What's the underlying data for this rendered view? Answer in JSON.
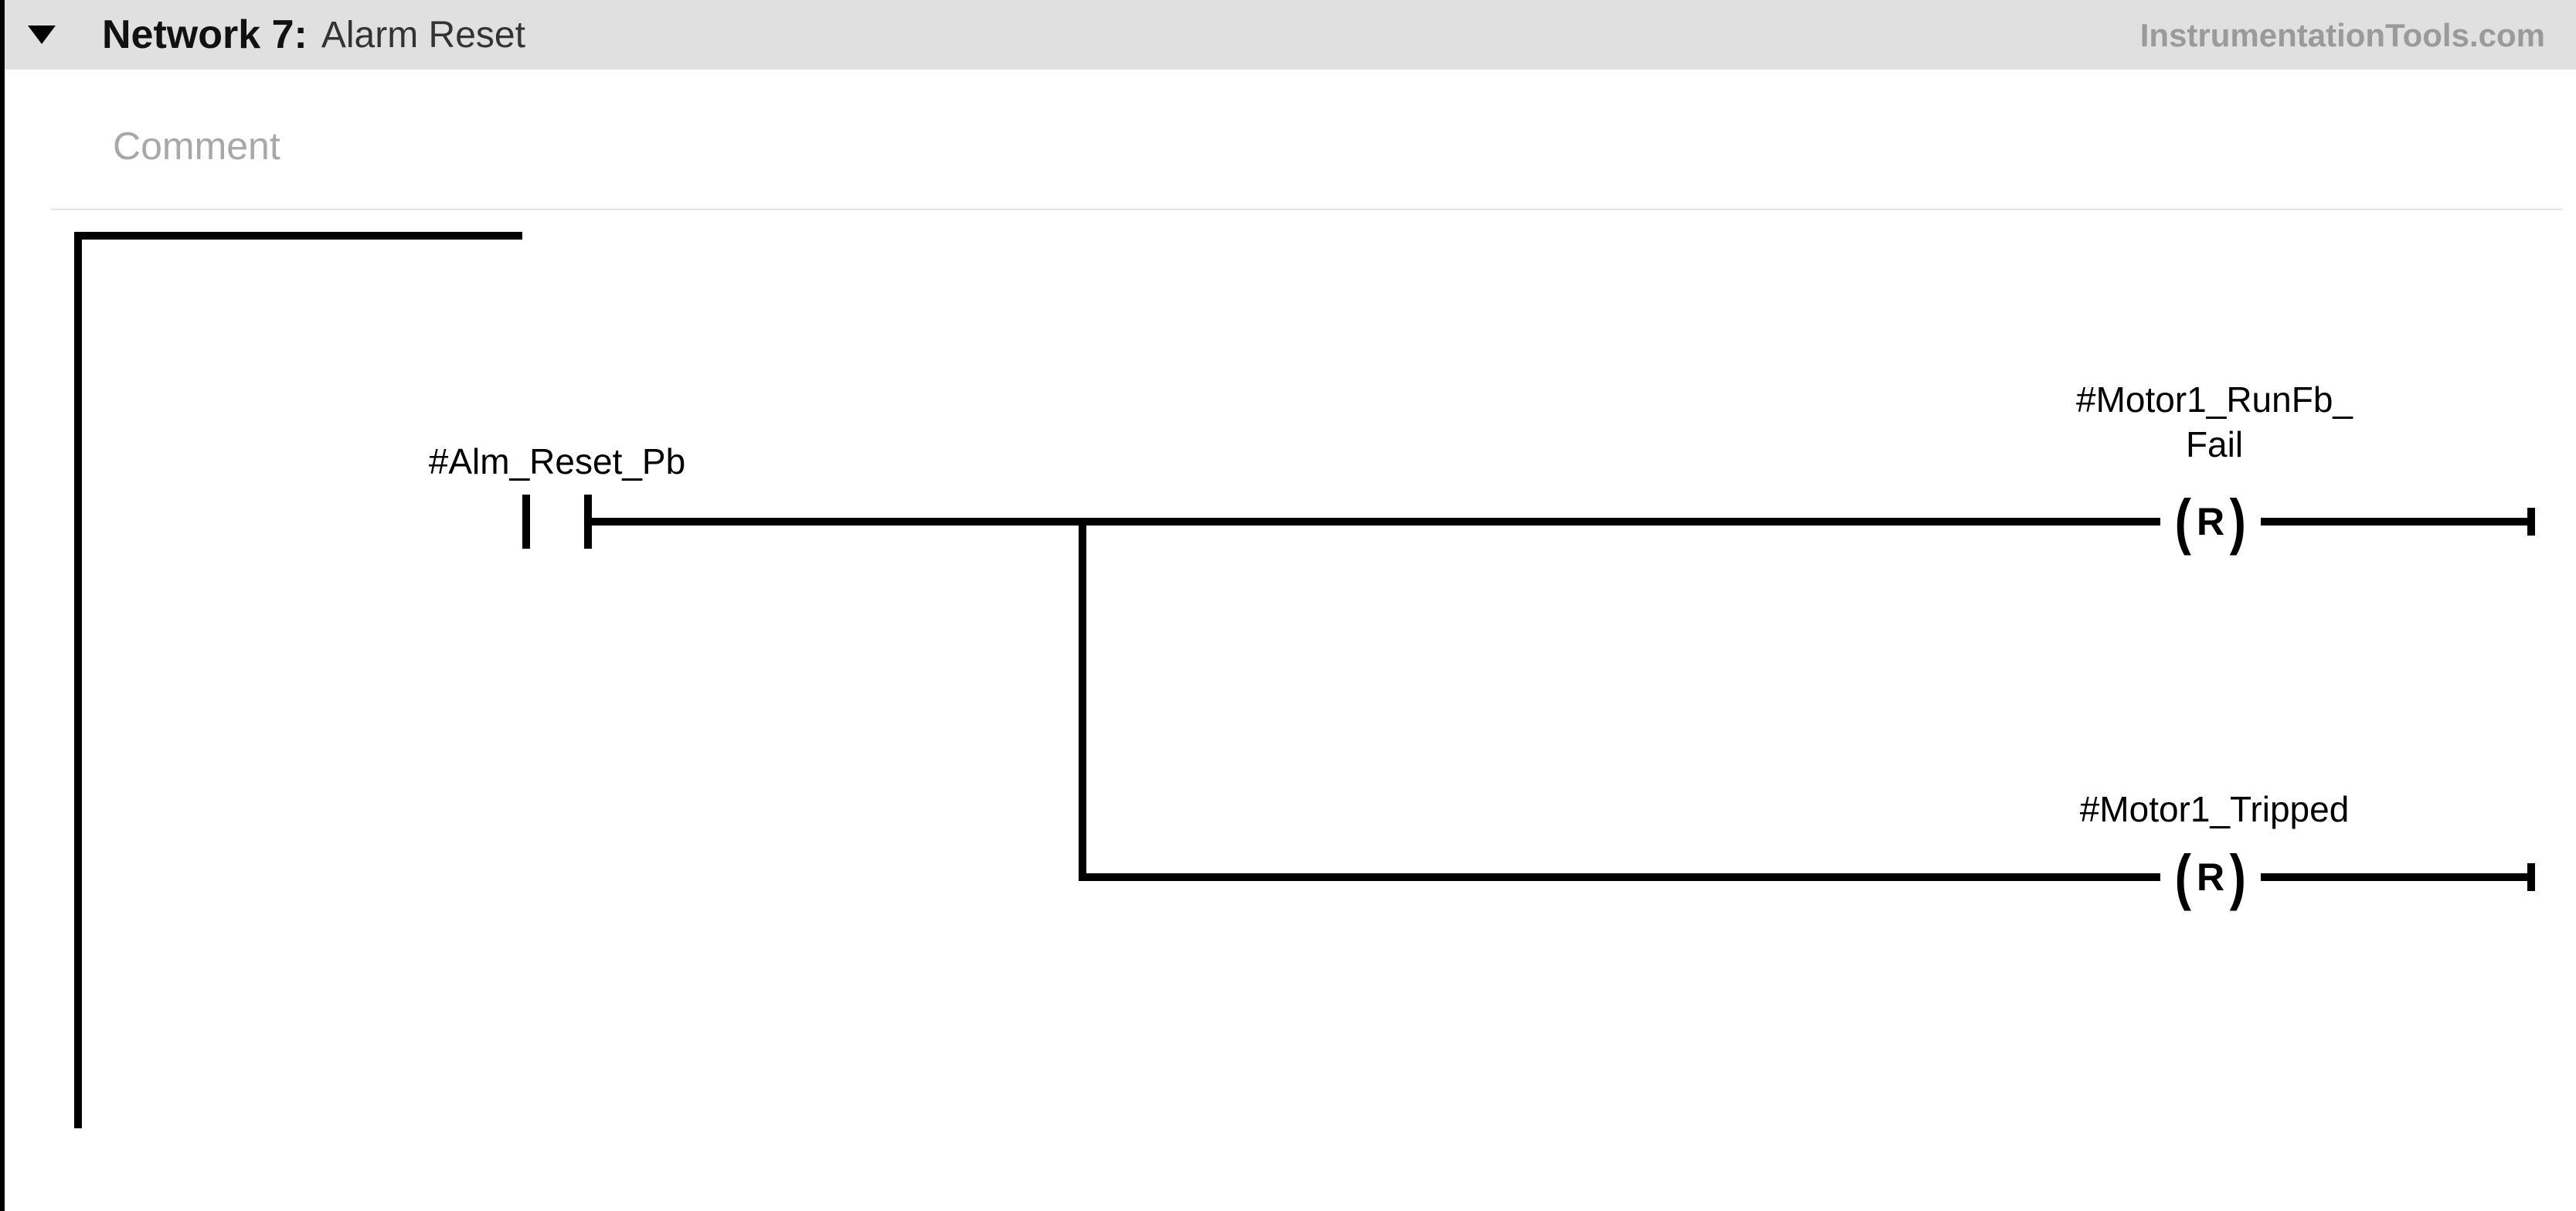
{
  "header": {
    "network_label": "Network 7:",
    "title": "Alarm Reset",
    "watermark": "InstrumentationTools.com"
  },
  "comment_placeholder": "Comment",
  "ladder": {
    "contact": {
      "tag": "#Alm_Reset_Pb"
    },
    "coils": [
      {
        "tag_line1": "#Motor1_RunFb_",
        "tag_line2": "Fail",
        "type": "R"
      },
      {
        "tag_line1": "#Motor1_Tripped",
        "tag_line2": "",
        "type": "R"
      }
    ]
  }
}
